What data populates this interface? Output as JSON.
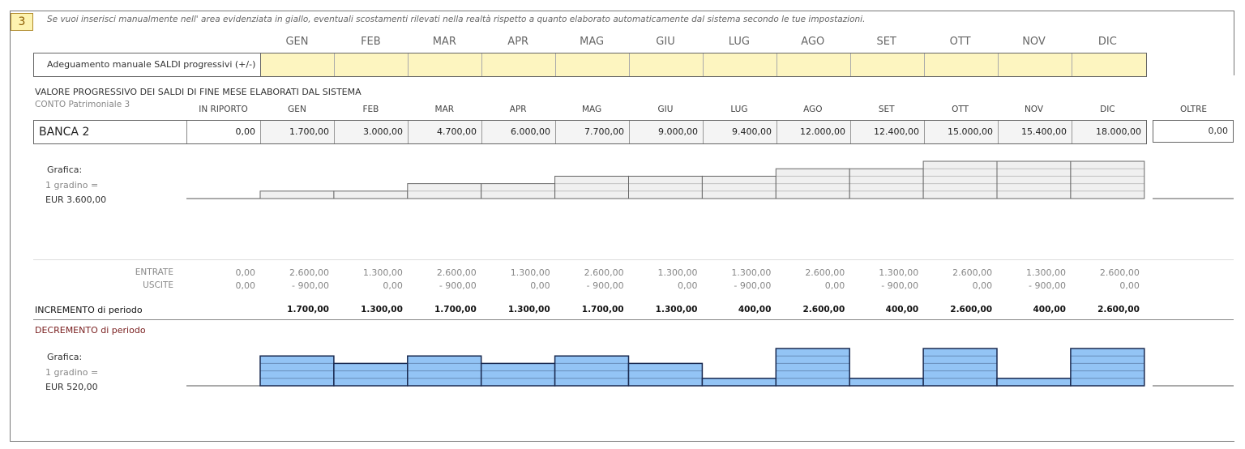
{
  "section_number": "3",
  "instructions": "Se vuoi inserisci manualmente nell' area evidenziata in giallo, eventuali scostamenti rilevati nella realtà rispetto a quanto elaborato automaticamente dal sistema secondo le tue impostazioni.",
  "months": [
    "GEN",
    "FEB",
    "MAR",
    "APR",
    "MAG",
    "GIU",
    "LUG",
    "AGO",
    "SET",
    "OTT",
    "NOV",
    "DIC"
  ],
  "adjustment": {
    "label": "Adeguamento manuale SALDI progressivi (+/-)",
    "values": [
      "",
      "",
      "",
      "",
      "",
      "",
      "",
      "",
      "",
      "",
      "",
      ""
    ],
    "highlight_color": "#fdf5c0"
  },
  "balances": {
    "title": "VALORE PROGRESSIVO DEI SALDI DI FINE MESE ELABORATI DAL SISTEMA",
    "account": "CONTO Patrimoniale 3",
    "carry_header": "IN RIPORTO",
    "beyond_header": "OLTRE",
    "bank": "BANCA 2",
    "carry": "0,00",
    "values": [
      "1.700,00",
      "3.000,00",
      "4.700,00",
      "6.000,00",
      "7.700,00",
      "9.000,00",
      "9.400,00",
      "12.000,00",
      "12.400,00",
      "15.000,00",
      "15.400,00",
      "18.000,00"
    ],
    "beyond": "0,00"
  },
  "chart_balance": {
    "label": "Grafica:",
    "step_label": "1 gradino =",
    "step_value": "EUR 3.600,00",
    "step": 3600,
    "values": [
      1700,
      3000,
      4700,
      6000,
      7700,
      9000,
      9400,
      12000,
      12400,
      15000,
      15400,
      18000
    ],
    "fill": "#f0f0f0",
    "stroke": "#666"
  },
  "flows": {
    "income_label": "ENTRATE",
    "expense_label": "USCITE",
    "income_carry": "0,00",
    "expense_carry": "0,00",
    "income": [
      "2.600,00",
      "1.300,00",
      "2.600,00",
      "1.300,00",
      "2.600,00",
      "1.300,00",
      "1.300,00",
      "2.600,00",
      "1.300,00",
      "2.600,00",
      "1.300,00",
      "2.600,00"
    ],
    "expense": [
      "- 900,00",
      "0,00",
      "- 900,00",
      "0,00",
      "- 900,00",
      "0,00",
      "- 900,00",
      "0,00",
      "- 900,00",
      "0,00",
      "- 900,00",
      "0,00"
    ],
    "increment_label": "INCREMENTO di periodo",
    "increment": [
      "1.700,00",
      "1.300,00",
      "1.700,00",
      "1.300,00",
      "1.700,00",
      "1.300,00",
      "400,00",
      "2.600,00",
      "400,00",
      "2.600,00",
      "400,00",
      "2.600,00"
    ],
    "decrement_label": "DECREMENTO di periodo"
  },
  "chart_increment": {
    "label": "Grafica:",
    "step_label": "1 gradino =",
    "step_value": "EUR 520,00",
    "step": 520,
    "values": [
      1700,
      1300,
      1700,
      1300,
      1700,
      1300,
      400,
      2600,
      400,
      2600,
      400,
      2600
    ],
    "fill": "#93c4f5",
    "stroke": "#1a2a50"
  }
}
